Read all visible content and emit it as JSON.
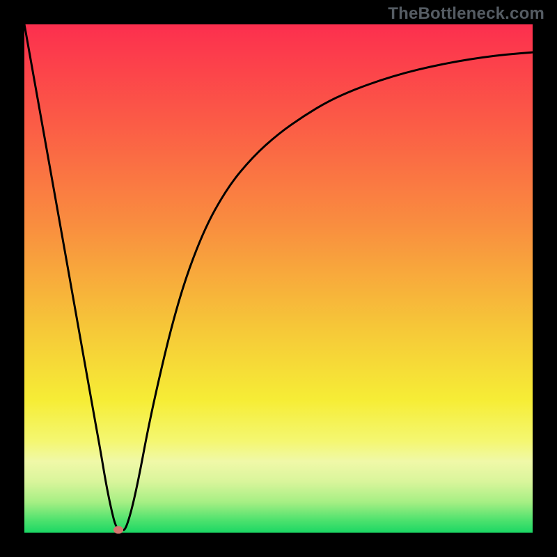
{
  "watermark": "TheBottleneck.com",
  "chart_data": {
    "type": "line",
    "title": "",
    "xlabel": "",
    "ylabel": "",
    "xlim": [
      0,
      100
    ],
    "ylim": [
      0,
      100
    ],
    "grid": false,
    "legend": false,
    "series": [
      {
        "name": "bottleneck-curve",
        "color": "#000000",
        "x": [
          0,
          5,
          10,
          13,
          15,
          16,
          17,
          18,
          19,
          20,
          22,
          25,
          30,
          35,
          40,
          45,
          50,
          55,
          60,
          65,
          70,
          75,
          80,
          85,
          90,
          95,
          100
        ],
        "y": [
          100,
          72,
          44,
          27,
          16,
          10,
          5,
          1,
          0.5,
          0.5,
          8,
          24,
          45,
          59,
          68,
          74,
          78.5,
          82,
          85,
          87.2,
          89,
          90.5,
          91.7,
          92.7,
          93.5,
          94.1,
          94.5
        ]
      }
    ],
    "markers": [
      {
        "name": "optimal-point",
        "x": 18.5,
        "y": 0.5,
        "color": "#d6776f",
        "size": 14
      }
    ],
    "background_gradient": {
      "type": "vertical",
      "stops": [
        {
          "pos": 0.0,
          "color": "#fc2f4e"
        },
        {
          "pos": 0.2,
          "color": "#fb5d46"
        },
        {
          "pos": 0.4,
          "color": "#f98f3f"
        },
        {
          "pos": 0.6,
          "color": "#f6c838"
        },
        {
          "pos": 0.74,
          "color": "#f6ed36"
        },
        {
          "pos": 0.82,
          "color": "#f4f771"
        },
        {
          "pos": 0.86,
          "color": "#f0f8a8"
        },
        {
          "pos": 0.9,
          "color": "#d9f59b"
        },
        {
          "pos": 0.94,
          "color": "#a6ef84"
        },
        {
          "pos": 0.975,
          "color": "#4fe26e"
        },
        {
          "pos": 1.0,
          "color": "#1bd764"
        }
      ]
    },
    "annotations": []
  }
}
